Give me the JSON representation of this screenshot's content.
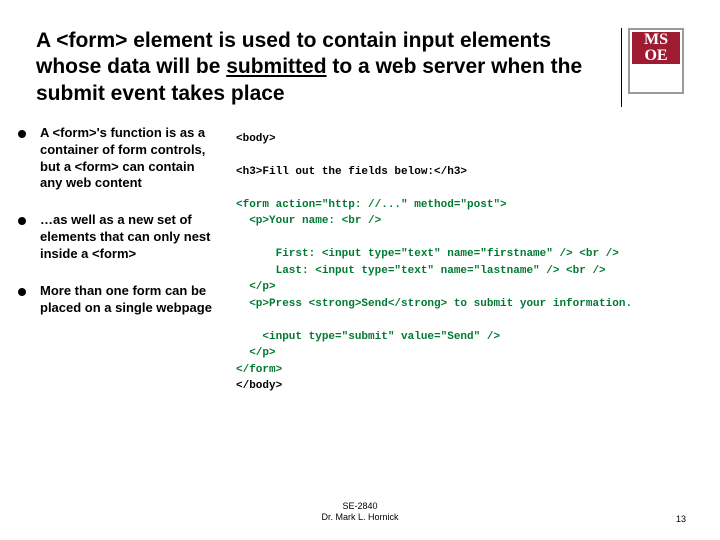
{
  "logo": {
    "line1": "MS",
    "line2": "OE"
  },
  "title_parts": {
    "pre": "A <form> element is used to contain input elements whose data will be ",
    "underlined": "submitted",
    "mid": " to a web server when the ",
    "bold": "submit",
    "post": " event takes place"
  },
  "bullets": [
    "A <form>'s function is as a container of form controls, but a <form> can contain any web content",
    "…as well as a new set of elements that can only nest inside a <form>",
    "More than one form can be placed on a single webpage"
  ],
  "code": {
    "l1": "<body>",
    "l2": "",
    "l3": "<h3>Fill out the fields below:</h3>",
    "l4": "",
    "f1": "<form action=\"http: //...\" method=\"post\">",
    "f2": "  <p>Your name: <br />",
    "f3": "",
    "f4": "      First: <input type=\"text\" name=\"firstname\" /> <br />",
    "f5": "      Last: <input type=\"text\" name=\"lastname\" /> <br />",
    "f6": "  </p>",
    "f7": "  <p>Press <strong>Send</strong> to submit your information.",
    "f8": "",
    "f9": "    <input type=\"submit\" value=\"Send\" />",
    "f10": "  </p>",
    "f11": "</form>",
    "l5": "</body>"
  },
  "footer": {
    "course": "SE-2840",
    "author": "Dr. Mark L. Hornick"
  },
  "page_number": "13"
}
